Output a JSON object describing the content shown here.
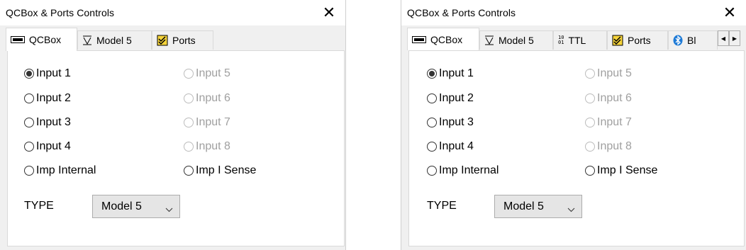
{
  "left_window": {
    "title": "QCBox & Ports Controls",
    "tabs": [
      {
        "label": "QCBox",
        "icon": "qcbox-device-icon"
      },
      {
        "label": "Model 5",
        "icon": "model-v-icon"
      },
      {
        "label": "Ports",
        "icon": "ports-check-icon"
      }
    ],
    "radios_left": [
      "Input 1",
      "Input 2",
      "Input 3",
      "Input 4",
      "Imp Internal"
    ],
    "radios_right": [
      "Input 5",
      "Input 6",
      "Input 7",
      "Input 8",
      "Imp I Sense"
    ],
    "selected_input": "Input 1",
    "type_label": "TYPE",
    "type_value": "Model 5"
  },
  "right_window": {
    "title": "QCBox & Ports Controls",
    "tabs": [
      {
        "label": "QCBox",
        "icon": "qcbox-device-icon"
      },
      {
        "label": "Model 5",
        "icon": "model-v-icon"
      },
      {
        "label": "TTL",
        "icon": "ttl-binary-icon",
        "icon_text_top": "10",
        "icon_text_bottom": "01"
      },
      {
        "label": "Ports",
        "icon": "ports-check-icon"
      },
      {
        "label": "Bl",
        "icon": "bluetooth-icon"
      }
    ],
    "radios_left": [
      "Input 1",
      "Input 2",
      "Input 3",
      "Input 4",
      "Imp Internal"
    ],
    "radios_right": [
      "Input 5",
      "Input 6",
      "Input 7",
      "Input 8",
      "Imp I Sense"
    ],
    "selected_input": "Input 1",
    "type_label": "TYPE",
    "type_value": "Model 5"
  },
  "colors": {
    "window_bg": "#f0f0f0",
    "panel_bg": "#ffffff",
    "disabled_text": "#a0a0a0",
    "bluetooth_blue": "#1e7ad6",
    "ports_icon_yellow": "#f5d33a"
  }
}
